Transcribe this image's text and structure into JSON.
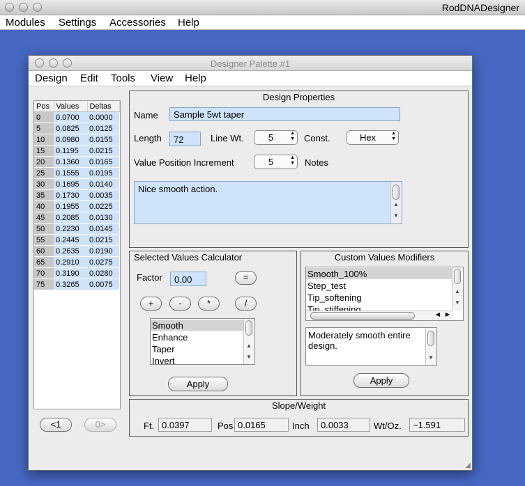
{
  "app": {
    "title": "RodDNADesigner",
    "menu": [
      "Modules",
      "Settings",
      "Accessories",
      "Help"
    ]
  },
  "palette": {
    "title": "Designer Palette #1",
    "menu": [
      "Design",
      "Edit",
      "Tools",
      "View",
      "Help"
    ],
    "table": {
      "headers": [
        "Pos",
        "Values",
        "Deltas"
      ],
      "rows": [
        [
          "0",
          "0.0700",
          "0.0000"
        ],
        [
          "5",
          "0.0825",
          "0.0125"
        ],
        [
          "10",
          "0.0980",
          "0.0155"
        ],
        [
          "15",
          "0.1195",
          "0.0215"
        ],
        [
          "20",
          "0.1360",
          "0.0165"
        ],
        [
          "25",
          "0.1555",
          "0.0195"
        ],
        [
          "30",
          "0.1695",
          "0.0140"
        ],
        [
          "35",
          "0.1730",
          "0.0035"
        ],
        [
          "40",
          "0.1955",
          "0.0225"
        ],
        [
          "45",
          "0.2085",
          "0.0130"
        ],
        [
          "50",
          "0.2230",
          "0.0145"
        ],
        [
          "55",
          "0.2445",
          "0.0215"
        ],
        [
          "60",
          "0.2635",
          "0.0190"
        ],
        [
          "65",
          "0.2910",
          "0.0275"
        ],
        [
          "70",
          "0.3190",
          "0.0280"
        ],
        [
          "75",
          "0.3265",
          "0.0075"
        ]
      ]
    },
    "nav": {
      "prev": "<1",
      "next": "0>"
    },
    "design_properties": {
      "title": "Design Properties",
      "name_label": "Name",
      "name_value": "Sample 5wt taper",
      "length_label": "Length",
      "length_value": "72",
      "line_wt_label": "Line Wt.",
      "line_wt_value": "5",
      "const_label": "Const.",
      "const_value": "Hex",
      "vpi_label": "Value Position Increment",
      "vpi_value": "5",
      "notes_label": "Notes",
      "notes_value": "Nice smooth action."
    },
    "calculator": {
      "title": "Selected Values Calculator",
      "factor_label": "Factor",
      "factor_value": "0.00",
      "equals": "=",
      "ops": [
        "+",
        "-",
        "*",
        "/"
      ],
      "list": [
        "Smooth",
        "Enhance",
        "Taper",
        "Invert"
      ],
      "selected": "Smooth",
      "apply": "Apply"
    },
    "custom": {
      "title": "Custom Values Modifiers",
      "list": [
        "Smooth_100%",
        "Step_test",
        "Tip_softening",
        "Tip_stiffening"
      ],
      "selected": "Smooth_100%",
      "description": "Moderately smooth entire design.",
      "apply": "Apply"
    },
    "slope": {
      "title": "Slope/Weight",
      "ft_label": "Ft.",
      "ft_value": "0.0397",
      "pos_label": "Pos",
      "pos_value": "0.0165",
      "inch_label": "Inch",
      "inch_value": "0.0033",
      "wt_label": "Wt/Oz.",
      "wt_value": "~1.591"
    }
  }
}
